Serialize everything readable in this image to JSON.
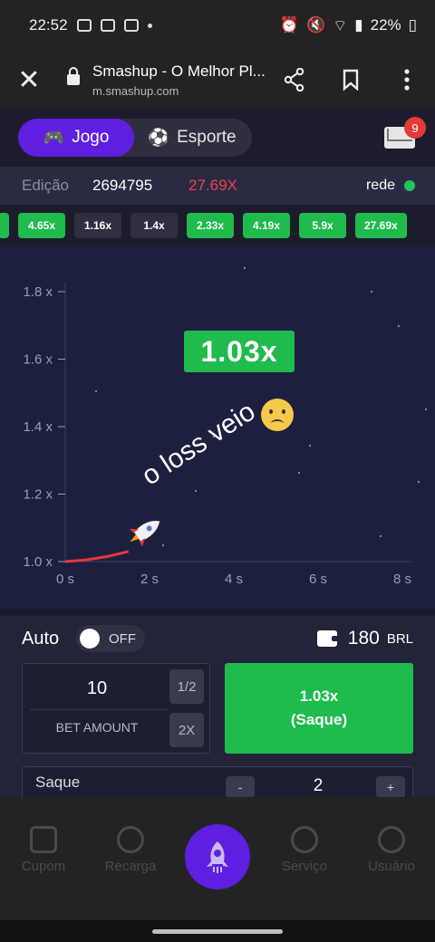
{
  "status_bar": {
    "time": "22:52",
    "battery": "22%"
  },
  "browser": {
    "title": "Smashup - O Melhor Pl...",
    "url": "m.smashup.com",
    "icons": [
      "close-icon",
      "lock-icon",
      "share-icon",
      "bookmark-icon",
      "more-vert-icon"
    ]
  },
  "header": {
    "tabs": [
      {
        "label": "Jogo",
        "icon": "gamepad-icon",
        "active": true
      },
      {
        "label": "Esporte",
        "icon": "soccer-ball-icon",
        "active": false
      }
    ],
    "mail_badge": "9"
  },
  "edition": {
    "label": "Edição",
    "number": "2694795",
    "multiplier": "27.69X",
    "network_label": "rede"
  },
  "history": [
    {
      "value": "",
      "color": "green"
    },
    {
      "value": "4.65x",
      "color": "green"
    },
    {
      "value": "1.16x",
      "color": "gray"
    },
    {
      "value": "1.4x",
      "color": "gray"
    },
    {
      "value": "2.33x",
      "color": "green"
    },
    {
      "value": "4.19x",
      "color": "green"
    },
    {
      "value": "5.9x",
      "color": "green"
    },
    {
      "value": "27.69x",
      "color": "green"
    }
  ],
  "game": {
    "current_multiplier": "1.03x",
    "overlay_caption": "o loss veio",
    "y_ticks": [
      "1.8 x",
      "1.6 x",
      "1.4 x",
      "1.2 x",
      "1.0 x"
    ],
    "x_ticks": [
      "0 s",
      "2 s",
      "4 s",
      "6 s",
      "8 s"
    ]
  },
  "chart_data": {
    "type": "line",
    "x": [
      0,
      0.5,
      1.0,
      1.5
    ],
    "y": [
      1.0,
      1.005,
      1.015,
      1.03
    ],
    "xlabel": "",
    "ylabel": "",
    "xlim": [
      0,
      8
    ],
    "ylim": [
      1.0,
      1.8
    ],
    "x_tick_labels": [
      "0 s",
      "2 s",
      "4 s",
      "6 s",
      "8 s"
    ],
    "y_tick_labels": [
      "1.0 x",
      "1.2 x",
      "1.4 x",
      "1.6 x",
      "1.8 x"
    ],
    "grid": false,
    "line_color": "#e53935"
  },
  "controls": {
    "auto_label": "Auto",
    "toggle_state": "OFF",
    "balance": "180",
    "currency": "BRL",
    "bet_value": "10",
    "bet_label": "BET AMOUNT",
    "half_label": "1/2",
    "double_label": "2X",
    "cashout_value": "1.03x",
    "cashout_label": "(Saque)",
    "saque_label": "Saque",
    "saque_minus": "-",
    "saque_value": "2",
    "saque_plus": "+"
  },
  "bottom_nav": [
    {
      "label": "Cupom",
      "icon": "coupon-icon"
    },
    {
      "label": "Recarga",
      "icon": "money-bag-icon"
    },
    {
      "label": "",
      "icon": "rocket-icon"
    },
    {
      "label": "Serviço",
      "icon": "headset-icon"
    },
    {
      "label": "Usuário",
      "icon": "user-icon"
    }
  ],
  "colors": {
    "accent_purple": "#5e1fe0",
    "green": "#1fbb4c",
    "red": "#ef4444",
    "chart_bg": "#1d1f3f"
  }
}
